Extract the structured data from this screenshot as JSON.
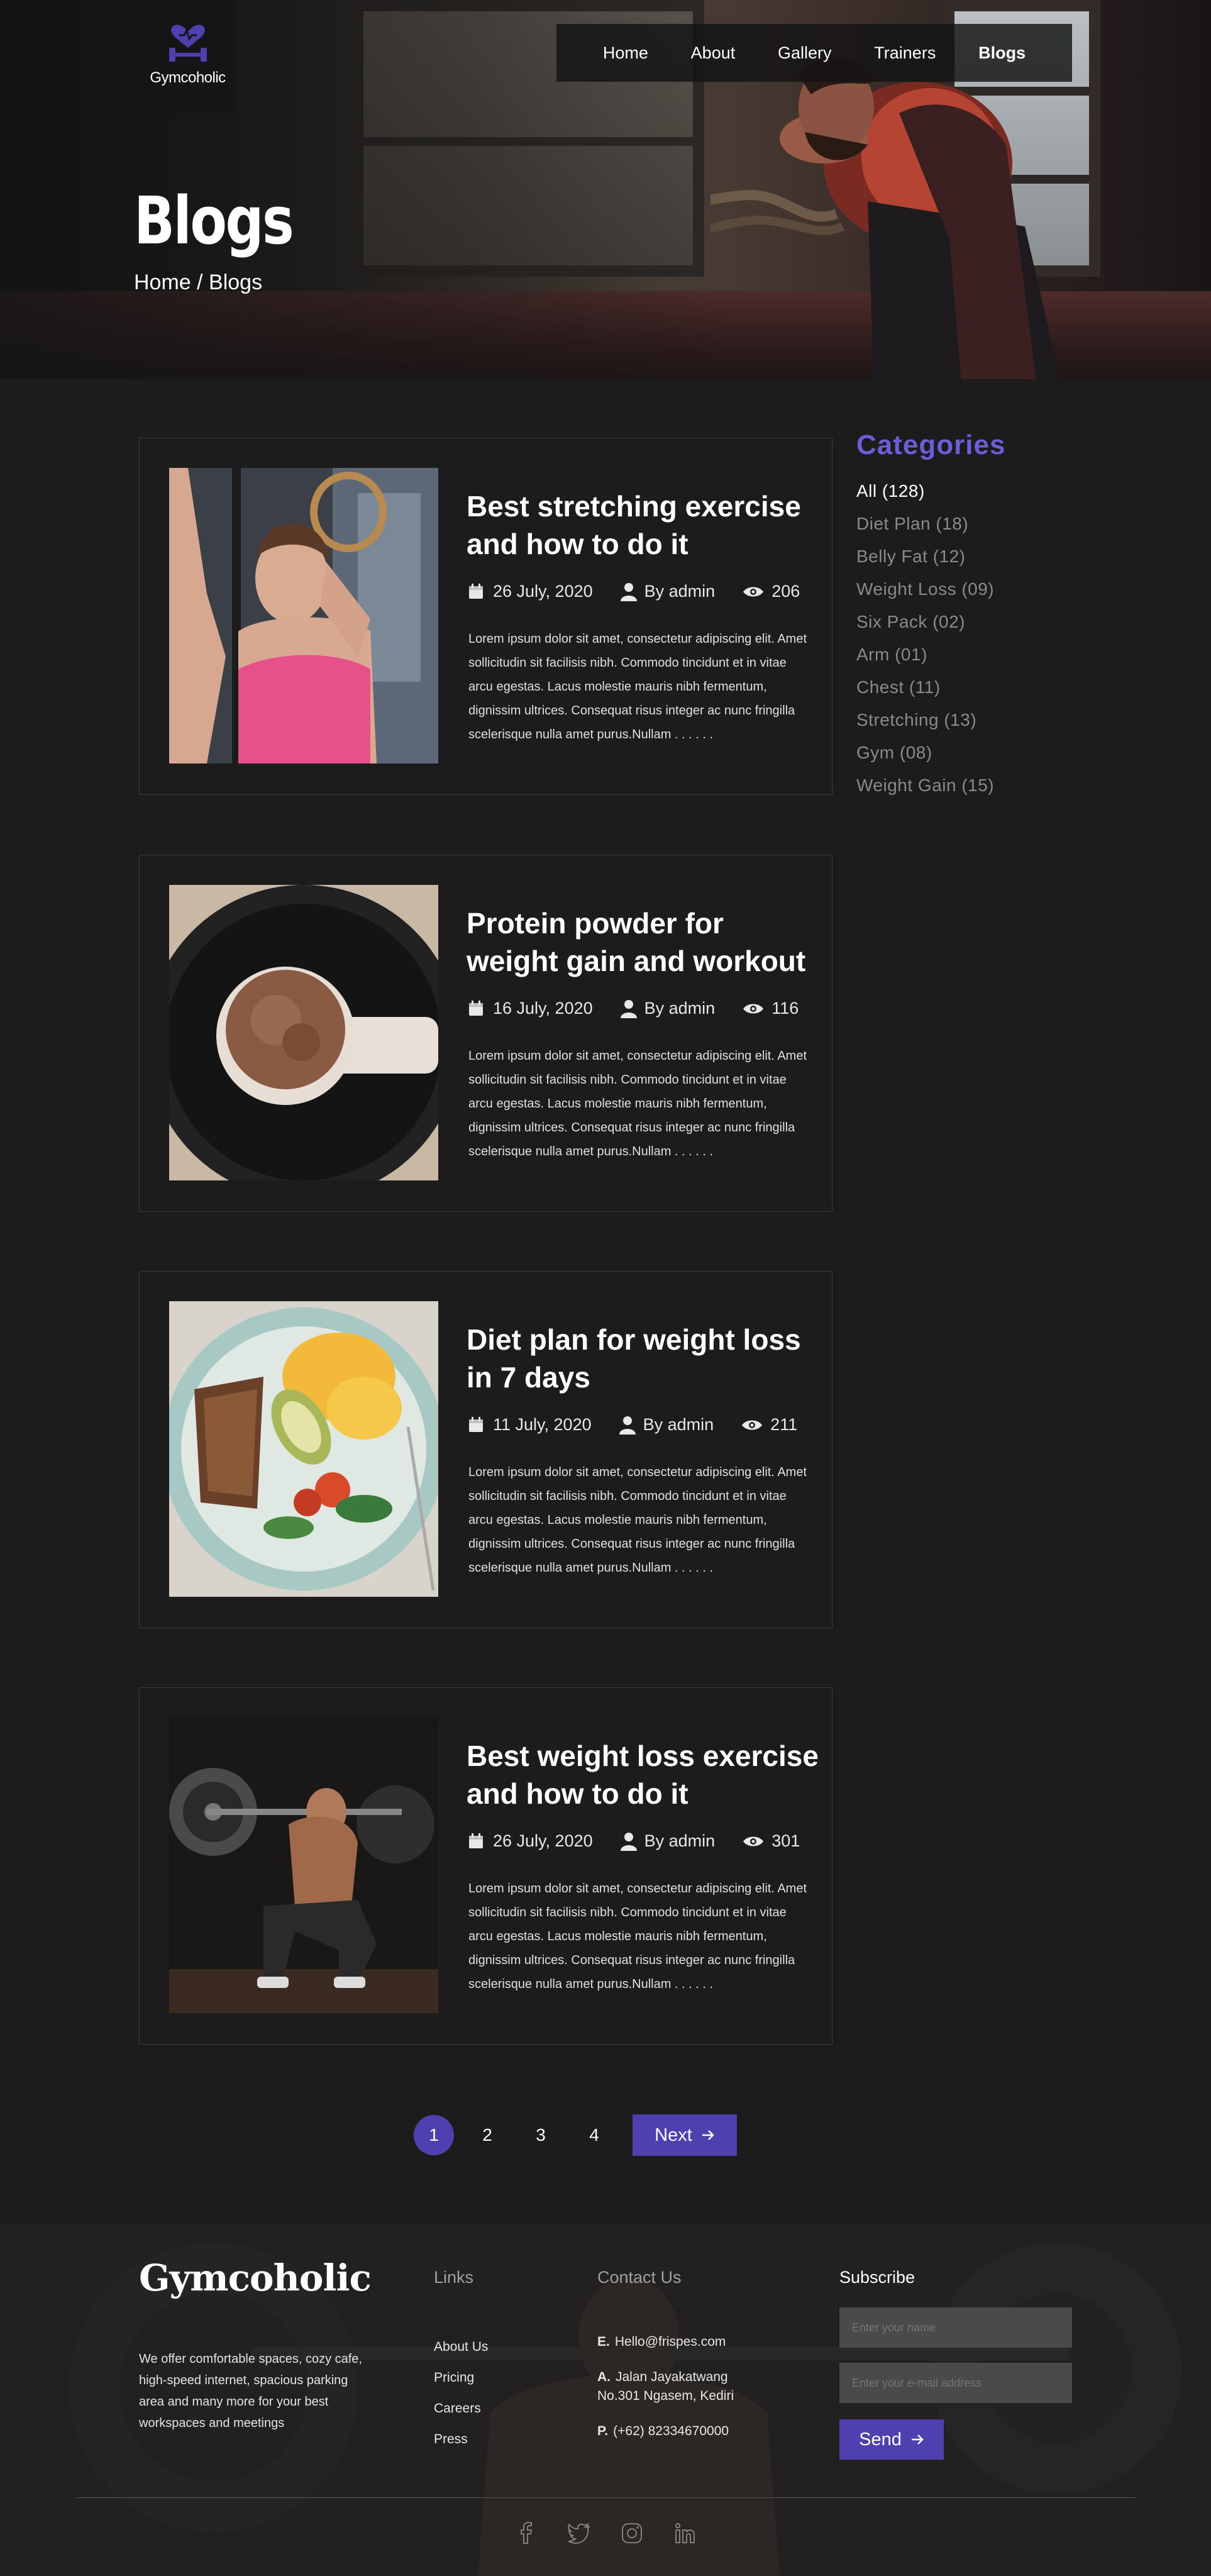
{
  "brand": {
    "logo_text": "Gymcoholic",
    "accent": "#4f40b0",
    "category_accent": "#6c5ed8"
  },
  "nav": {
    "items": [
      {
        "label": "Home"
      },
      {
        "label": "About"
      },
      {
        "label": "Gallery"
      },
      {
        "label": "Trainers"
      },
      {
        "label": "Blogs",
        "active": true
      }
    ]
  },
  "hero": {
    "title": "Blogs",
    "breadcrumb": "Home / Blogs"
  },
  "posts": [
    {
      "title": "Best stretching exercise and how to do it",
      "date": "26 July, 2020",
      "author": "By admin",
      "views": "206",
      "excerpt": "Lorem ipsum dolor sit amet, consectetur adipiscing elit. Amet sollicitudin sit facilisis nibh. Commodo tincidunt et in vitae arcu egestas. Lacus molestie mauris nibh fermentum, dignissim ultrices. Consequat risus integer ac nunc fringilla scelerisque nulla amet purus.Nullam . . . . . ."
    },
    {
      "title": "Protein powder for weight gain and workout",
      "date": "16 July, 2020",
      "author": "By admin",
      "views": "116",
      "excerpt": "Lorem ipsum dolor sit amet, consectetur adipiscing elit. Amet sollicitudin sit facilisis nibh. Commodo tincidunt et in vitae arcu egestas. Lacus molestie mauris nibh fermentum, dignissim ultrices. Consequat risus integer ac nunc fringilla scelerisque nulla amet purus.Nullam . . . . . ."
    },
    {
      "title": "Diet plan for weight loss in 7 days",
      "date": "11 July, 2020",
      "author": "By admin",
      "views": "211",
      "excerpt": "Lorem ipsum dolor sit amet, consectetur adipiscing elit. Amet sollicitudin sit facilisis nibh. Commodo tincidunt et in vitae arcu egestas. Lacus molestie mauris nibh fermentum, dignissim ultrices. Consequat risus integer ac nunc fringilla scelerisque nulla amet purus.Nullam . . . . . ."
    },
    {
      "title": "Best weight loss exercise and how to do it",
      "date": "26 July, 2020",
      "author": "By admin",
      "views": "301",
      "excerpt": "Lorem ipsum dolor sit amet, consectetur adipiscing elit. Amet sollicitudin sit facilisis nibh. Commodo tincidunt et in vitae arcu egestas. Lacus molestie mauris nibh fermentum, dignissim ultrices. Consequat risus integer ac nunc fringilla scelerisque nulla amet purus.Nullam . . . . . ."
    }
  ],
  "sidebar": {
    "title": "Categories",
    "items": [
      "All (128)",
      "Diet Plan (18)",
      "Belly Fat (12)",
      "Weight Loss (09)",
      "Six Pack (02)",
      "Arm (01)",
      "Chest (11)",
      "Stretching (13)",
      "Gym (08)",
      "Weight Gain (15)"
    ]
  },
  "pagination": {
    "pages": [
      "1",
      "2",
      "3",
      "4"
    ],
    "current": "1",
    "next_label": "Next"
  },
  "footer": {
    "brand": "Gymcoholic",
    "about": "We offer comfortable spaces, cozy cafe, high-speed internet, spacious parking area and many more for your best workspaces and meetings",
    "links_title": "Links",
    "links": [
      "About Us",
      "Pricing",
      "Careers",
      "Press"
    ],
    "contact_title": "Contact Us",
    "email_prefix": "E.",
    "email": "Hello@frispes.com",
    "address_prefix": "A.",
    "address_line1": "Jalan Jayakatwang",
    "address_line2": "No.301 Ngasem, Kediri",
    "phone_prefix": "P.",
    "phone": "(+62) 82334670000",
    "subscribe_title": "Subscribe",
    "name_placeholder": "Enter your name",
    "email_placeholder": "Enter your e-mail address",
    "send_label": "Send",
    "social": [
      "facebook-icon",
      "twitter-icon",
      "instagram-icon",
      "linkedin-icon"
    ]
  }
}
